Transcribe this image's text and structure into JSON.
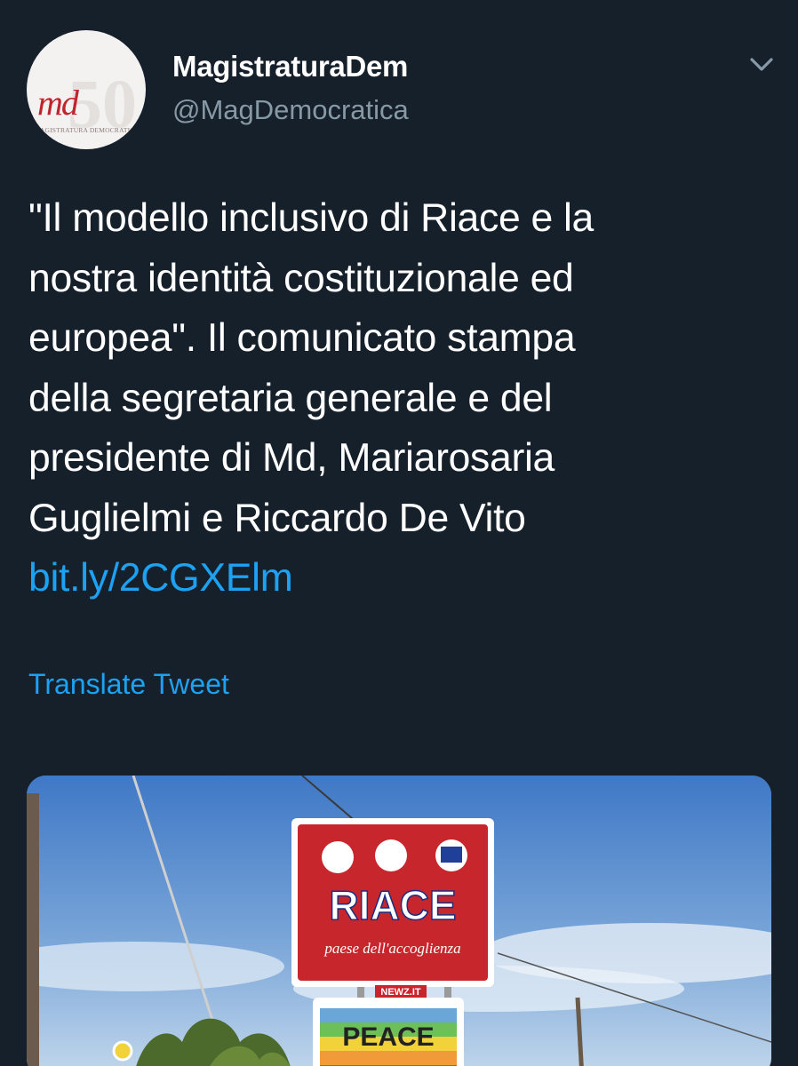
{
  "account": {
    "display_name": "MagistraturaDem",
    "handle": "@MagDemocratica",
    "avatar": {
      "logo_text": "md",
      "logo_subtext": "MAGISTRATURA DEMOCRATICA",
      "logo_number": "50"
    }
  },
  "menu": {
    "icon": "chevron-down-icon"
  },
  "tweet": {
    "lines": [
      "\"Il modello inclusivo di Riace e la",
      "nostra identità costituzionale ed",
      "europea\". Il comunicato stampa",
      "della segretaria generale e del",
      "presidente di Md, Mariarosaria",
      "Guglielmi e Riccardo De Vito"
    ],
    "link": "bit.ly/2CGXElm"
  },
  "translate_label": "Translate Tweet",
  "media": {
    "sign_title": "RIACE",
    "sign_subtitle": "paese dell'accoglienza",
    "watermark": "NEWZ.IT",
    "peace_label": "PEACE"
  },
  "colors": {
    "background": "#15202b",
    "link": "#1da1f2",
    "secondary_text": "#8899a6",
    "sign_red": "#c8262d"
  }
}
